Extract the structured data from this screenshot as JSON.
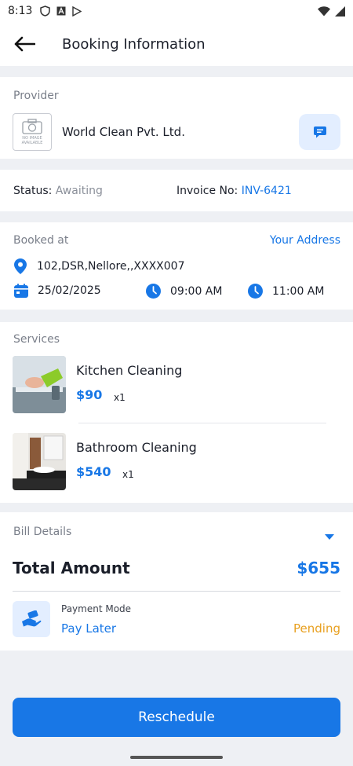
{
  "status_bar": {
    "time": "8:13"
  },
  "app_bar": {
    "title": "Booking Information"
  },
  "provider": {
    "label": "Provider",
    "name": "World Clean Pvt. Ltd.",
    "no_image_text": "NO IMAGE AVAILABLE"
  },
  "status": {
    "label": "Status:",
    "value": "Awaiting",
    "invoice_label": "Invoice No:",
    "invoice_value": "INV-6421"
  },
  "booking": {
    "label": "Booked at",
    "address_link": "Your Address",
    "address": "102,DSR,Nellore,,XXXX007",
    "date": "25/02/2025",
    "start_time": "09:00 AM",
    "end_time": "11:00 AM"
  },
  "services": {
    "label": "Services",
    "items": [
      {
        "name": "Kitchen Cleaning",
        "price": "$90",
        "qty": "x1"
      },
      {
        "name": "Bathroom Cleaning",
        "price": "$540",
        "qty": "x1"
      }
    ]
  },
  "bill": {
    "label": "Bill Details",
    "total_label": "Total Amount",
    "total_value": "$655",
    "payment_mode_label": "Payment Mode",
    "payment_mode_value": "Pay Later",
    "payment_status": "Pending"
  },
  "action": {
    "reschedule_label": "Reschedule"
  },
  "colors": {
    "accent": "#1877E6",
    "pending": "#E8A020",
    "muted": "#8A8F99",
    "background": "#EEF0F4"
  }
}
